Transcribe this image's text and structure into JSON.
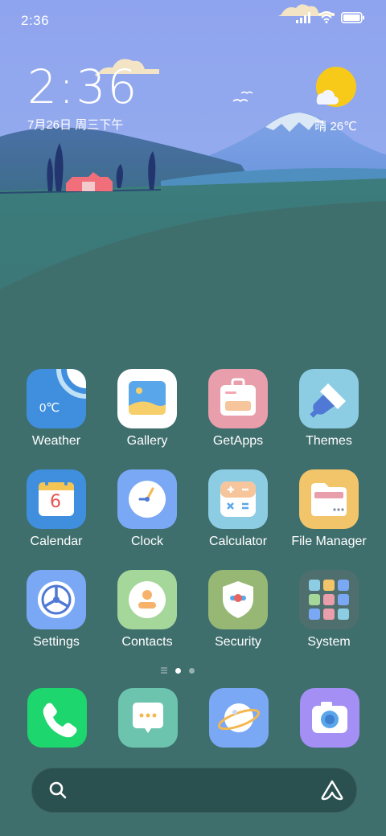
{
  "status_bar": {
    "time": "2:36"
  },
  "clock_widget": {
    "time": "2:36",
    "date": "7月26日 周三下午"
  },
  "weather_widget": {
    "text": "晴 26℃"
  },
  "apps": [
    {
      "label": "Weather",
      "icon": "weather-icon",
      "badge": "0℃",
      "color": "#3f8fde"
    },
    {
      "label": "Gallery",
      "icon": "gallery-icon",
      "color": "#ffffff"
    },
    {
      "label": "GetApps",
      "icon": "getapps-icon",
      "color": "#e99eab"
    },
    {
      "label": "Themes",
      "icon": "themes-icon",
      "color": "#8ccde4"
    },
    {
      "label": "Calendar",
      "icon": "calendar-icon",
      "badge": "6",
      "color": "#3f8fde"
    },
    {
      "label": "Clock",
      "icon": "clock-icon",
      "color": "#7aa8f5"
    },
    {
      "label": "Calculator",
      "icon": "calculator-icon",
      "color": "#8ccde4"
    },
    {
      "label": "File Manager",
      "icon": "folder-icon",
      "color": "#f3c56a"
    },
    {
      "label": "Settings",
      "icon": "settings-icon",
      "color": "#7aa8f5"
    },
    {
      "label": "Contacts",
      "icon": "contacts-icon",
      "color": "#a5d79b"
    },
    {
      "label": "Security",
      "icon": "security-icon",
      "color": "#97b774"
    },
    {
      "label": "System",
      "icon": "system-folder-icon",
      "color": "#4f6f6e"
    }
  ],
  "dock": [
    {
      "icon": "phone-icon",
      "color": "#1ed66e"
    },
    {
      "icon": "messages-icon",
      "color": "#6cc4ae"
    },
    {
      "icon": "browser-icon",
      "color": "#7aa8f5"
    },
    {
      "icon": "camera-icon",
      "color": "#a48ff5"
    }
  ],
  "search_bar": {
    "search_icon": "search-icon",
    "assistant_icon": "assistant-icon"
  }
}
